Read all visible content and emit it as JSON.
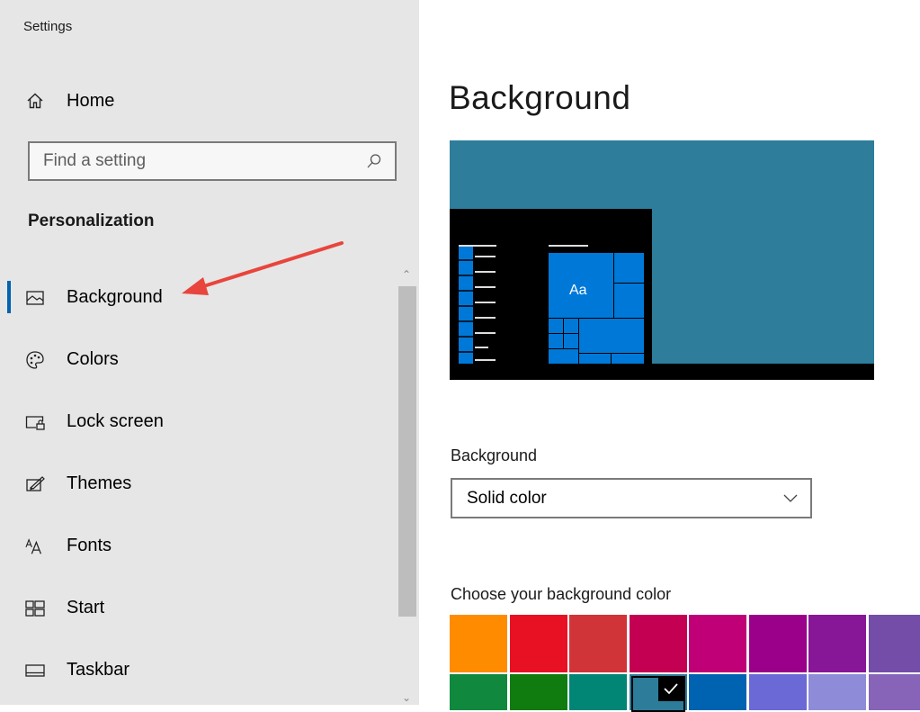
{
  "window": {
    "title": "Settings"
  },
  "sidebar": {
    "home_label": "Home",
    "home_icon": "home-icon",
    "search": {
      "placeholder": "Find a setting",
      "value": "",
      "icon": "search-icon"
    },
    "section_title": "Personalization",
    "items": [
      {
        "label": "Background",
        "icon": "picture-icon",
        "active": true
      },
      {
        "label": "Colors",
        "icon": "palette-icon",
        "active": false
      },
      {
        "label": "Lock screen",
        "icon": "lock-screen-icon",
        "active": false
      },
      {
        "label": "Themes",
        "icon": "themes-icon",
        "active": false
      },
      {
        "label": "Fonts",
        "icon": "fonts-icon",
        "active": false
      },
      {
        "label": "Start",
        "icon": "start-icon",
        "active": false
      },
      {
        "label": "Taskbar",
        "icon": "taskbar-icon",
        "active": false
      }
    ],
    "accent_color": "#0063b1"
  },
  "main": {
    "title": "Background",
    "preview": {
      "tile_label": "Aa",
      "desktop_color": "#2e7d9b",
      "tile_color": "#0078d7"
    },
    "background_label": "Background",
    "background_dropdown": {
      "selected": "Solid color"
    },
    "color_picker_label": "Choose your background color",
    "color_rows": [
      [
        "#ff8c00",
        "#e81123",
        "#d13438",
        "#c30052",
        "#bf0077",
        "#9a0089",
        "#881798",
        "#744da9"
      ],
      [
        "#10893e",
        "#107c10",
        "#018574",
        "#2d7d9a",
        "#0063b1",
        "#6b69d6",
        "#8e8cd8",
        "#8764b8"
      ]
    ],
    "selected_color": "#2d7d9a"
  },
  "annotation": {
    "arrow_color": "#e8453c"
  }
}
